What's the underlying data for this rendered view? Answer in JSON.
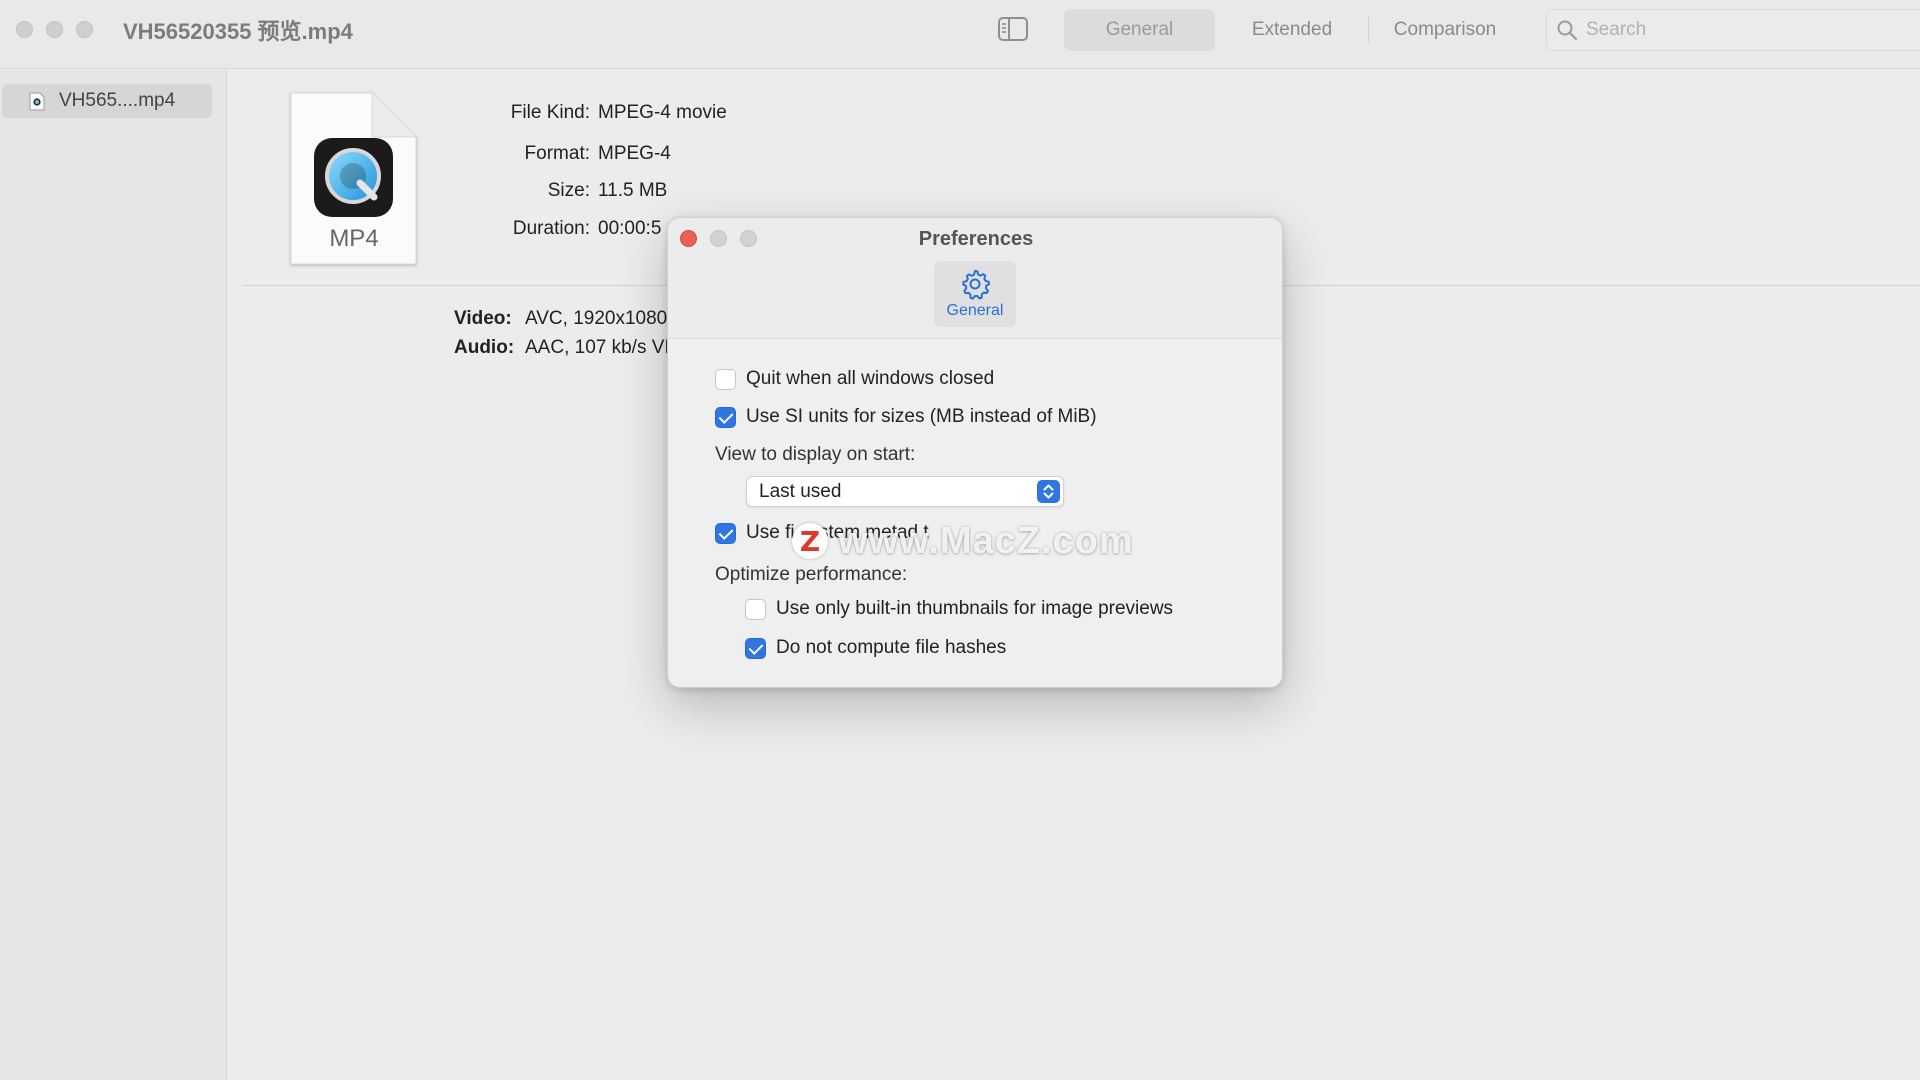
{
  "window": {
    "title": "VH56520355 预览.mp4"
  },
  "toolbar": {
    "tabs": [
      {
        "label": "General",
        "active": true
      },
      {
        "label": "Extended",
        "active": false
      },
      {
        "label": "Comparison",
        "active": false
      }
    ],
    "search_placeholder": "Search"
  },
  "sidebar": {
    "items": [
      {
        "label": "VH565....mp4",
        "selected": true
      }
    ]
  },
  "file": {
    "icon_label": "MP4",
    "fields": [
      {
        "key": "File Kind:",
        "value": "MPEG-4 movie"
      },
      {
        "key": "Format:",
        "value": "MPEG-4"
      },
      {
        "key": "Size:",
        "value": "11.5 MB"
      },
      {
        "key": "Duration:",
        "value": "00:00:5"
      }
    ],
    "tracks": [
      {
        "key": "Video:",
        "value": "AVC, 1920x1080"
      },
      {
        "key": "Audio:",
        "value": "AAC, 107 kb/s VI"
      }
    ]
  },
  "preferences": {
    "title": "Preferences",
    "tab_label": "General",
    "options": {
      "quit_when_closed": {
        "label": "Quit when all windows closed",
        "checked": false
      },
      "si_units": {
        "label": "Use SI units for sizes (MB instead of MiB)",
        "checked": true
      },
      "view_on_start_label": "View to display on start:",
      "view_on_start_value": "Last used",
      "file_system_metadata": {
        "label": "Use fi   system metad  t",
        "checked": true
      },
      "optimize_label": "Optimize performance:",
      "builtin_thumbnails": {
        "label": "Use only built-in thumbnails for image previews",
        "checked": false
      },
      "no_file_hashes": {
        "label": "Do not compute file hashes",
        "checked": true
      }
    },
    "watermark": "www.MacZ.com",
    "watermark_badge": "Z"
  },
  "colors": {
    "accent": "#2f76e3",
    "close_red": "#ec5f57",
    "tab_blue": "#2a6fd6"
  }
}
